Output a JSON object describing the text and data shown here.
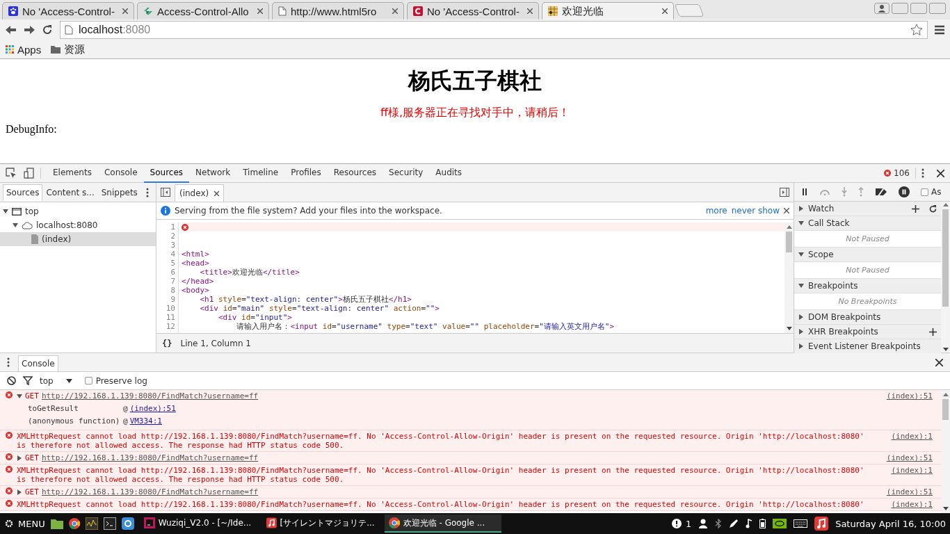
{
  "browser": {
    "tabs": [
      {
        "title": "No 'Access-Control-",
        "selected": false,
        "kind": "paw"
      },
      {
        "title": "Access-Control-Allo",
        "selected": false,
        "kind": "leaf"
      },
      {
        "title": "http://www.html5ro",
        "selected": false,
        "kind": "page"
      },
      {
        "title": "No 'Access-Control-",
        "selected": false,
        "kind": "logo"
      },
      {
        "title": "欢迎光临",
        "selected": true,
        "kind": "game"
      }
    ],
    "address": {
      "host": "localhost",
      "port": ":8080"
    },
    "bookmarks": [
      {
        "label": "Apps",
        "kind": "apps"
      },
      {
        "label": "资源",
        "kind": "folder"
      }
    ]
  },
  "page": {
    "heading": "杨氏五子棋社",
    "status": "ff様,服务器正在寻找对手中，请稍后！",
    "debug": "DebugInfo:"
  },
  "devtools": {
    "tabs": [
      {
        "label": "Elements",
        "selected": false
      },
      {
        "label": "Console",
        "selected": false
      },
      {
        "label": "Sources",
        "selected": true
      },
      {
        "label": "Network",
        "selected": false
      },
      {
        "label": "Timeline",
        "selected": false
      },
      {
        "label": "Profiles",
        "selected": false
      },
      {
        "label": "Resources",
        "selected": false
      },
      {
        "label": "Security",
        "selected": false
      },
      {
        "label": "Audits",
        "selected": false
      }
    ],
    "error_count": "106",
    "navigator": {
      "tabs": [
        {
          "label": "Sources",
          "selected": true
        },
        {
          "label": "Content s...",
          "selected": false
        },
        {
          "label": "Snippets",
          "selected": false
        }
      ],
      "tree": [
        {
          "label": "top",
          "kind": "frame",
          "selected": false,
          "expanded": true,
          "children": [
            {
              "label": "localhost:8080",
              "kind": "cloud",
              "selected": false,
              "expanded": true,
              "children": [
                {
                  "label": "(index)",
                  "kind": "file",
                  "selected": true
                }
              ]
            }
          ]
        }
      ]
    },
    "editor": {
      "tab": "(index)",
      "infobar": {
        "message": "Serving from the file system? Add your files into the workspace.",
        "links": [
          "more",
          "never show"
        ]
      },
      "lines": [
        {
          "number": "1",
          "error": true
        },
        {
          "number": "2",
          "error": false
        },
        {
          "number": "3",
          "error": false
        },
        {
          "number": "4",
          "error": false,
          "code": "<html>"
        },
        {
          "number": "5",
          "error": false,
          "code": "<head>"
        },
        {
          "number": "6",
          "error": false,
          "code": "    <title>欢迎光临</title>"
        },
        {
          "number": "7",
          "error": false,
          "code": "</head>"
        },
        {
          "number": "8",
          "error": false,
          "code": "<body>"
        },
        {
          "number": "9",
          "error": false,
          "code": "    <h1 style=\"text-align: center\">杨氏五子棋社</h1>"
        },
        {
          "number": "10",
          "error": false,
          "code": "    <div id=\"main\" style=\"text-align: center\" action=\"\">"
        },
        {
          "number": "11",
          "error": false,
          "code": "        <div id=\"input\">"
        },
        {
          "number": "12",
          "error": false,
          "code": "            请输入用户名：<input id=\"username\" type=\"text\" value=\"\" placeholder=\"请输入英文用户名\">"
        }
      ],
      "format_button": "{}",
      "position": "Line 1, Column 1"
    },
    "debugger": {
      "async_label": "As",
      "async_checked": false,
      "sections": [
        {
          "title": "Watch",
          "expanded": false,
          "kind": "watch"
        },
        {
          "title": "Call Stack",
          "expanded": true,
          "message": "Not Paused"
        },
        {
          "title": "Scope",
          "expanded": true,
          "message": "Not Paused"
        },
        {
          "title": "Breakpoints",
          "expanded": true,
          "message": "No Breakpoints"
        },
        {
          "title": "DOM Breakpoints",
          "expanded": false
        },
        {
          "title": "XHR Breakpoints",
          "expanded": false,
          "kind": "xhr"
        },
        {
          "title": "Event Listener Breakpoints",
          "expanded": false
        }
      ]
    },
    "console": {
      "tab": "Console",
      "context": "top",
      "preserve_log": {
        "label": "Preserve log",
        "checked": false
      },
      "messages": [
        {
          "kind": "get",
          "expanded": true,
          "method": "GET",
          "url": "http://192.168.1.139:8080/FindMatch?username=ff",
          "source": "(index):51",
          "stack": [
            {
              "function": "toGetResult",
              "at": "@",
              "link": "(index):51"
            },
            {
              "function": "(anonymous function)",
              "at": "@",
              "link": "VM334:1"
            }
          ]
        },
        {
          "kind": "error",
          "text": "XMLHttpRequest cannot load http://192.168.1.139:8080/FindMatch?username=ff. No 'Access-Control-Allow-Origin' header is present on the requested resource. Origin 'http://localhost:8080' is therefore not allowed access. The response had HTTP status code 500.",
          "source": "(index):1"
        },
        {
          "kind": "get",
          "expanded": false,
          "method": "GET",
          "url": "http://192.168.1.139:8080/FindMatch?username=ff",
          "source": "(index):51"
        },
        {
          "kind": "error",
          "text": "XMLHttpRequest cannot load http://192.168.1.139:8080/FindMatch?username=ff. No 'Access-Control-Allow-Origin' header is present on the requested resource. Origin 'http://localhost:8080' is therefore not allowed access. The response had HTTP status code 500.",
          "source": "(index):1"
        },
        {
          "kind": "get",
          "expanded": false,
          "method": "GET",
          "url": "http://192.168.1.139:8080/FindMatch?username=ff",
          "source": "(index):51"
        },
        {
          "kind": "error",
          "text": "XMLHttpRequest cannot load http://192.168.1.139:8080/FindMatch?username=ff. No 'Access-Control-Allow-Origin' header is present on the requested resource. Origin 'http://localhost:8080'",
          "source": "(index):1"
        }
      ]
    }
  },
  "taskbar": {
    "menu": "MENU",
    "windows": [
      {
        "title": "Wuziqi_V2.0 - [~/Ide...",
        "kind": "ide",
        "selected": false
      },
      {
        "title": "[サイレントマジョリテ...",
        "kind": "music",
        "selected": false
      },
      {
        "title": "欢迎光临 - Google ...",
        "kind": "browser",
        "selected": true
      }
    ],
    "notifications": "1",
    "clock": "Saturday April 16, 10:00"
  }
}
